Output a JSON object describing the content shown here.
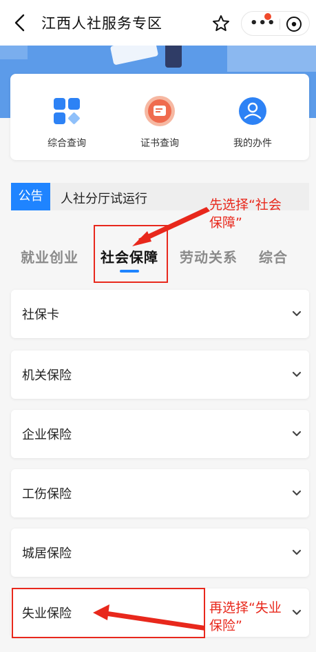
{
  "nav": {
    "title": "江西人社服务专区",
    "more_glyph": "•••"
  },
  "quick": [
    {
      "label": "综合查询",
      "icon": "grid-icon"
    },
    {
      "label": "证书查询",
      "icon": "certificate-icon"
    },
    {
      "label": "我的办件",
      "icon": "user-profile-icon"
    }
  ],
  "notice": {
    "tag": "公告",
    "text": "人社分厅试运行"
  },
  "tabs": [
    {
      "label": "就业创业"
    },
    {
      "label": "社会保障"
    },
    {
      "label": "劳动关系"
    },
    {
      "label": "综合"
    }
  ],
  "list": [
    {
      "label": "社保卡"
    },
    {
      "label": "机关保险"
    },
    {
      "label": "企业保险"
    },
    {
      "label": "工伤保险"
    },
    {
      "label": "城居保险"
    },
    {
      "label": "失业保险"
    }
  ],
  "annotations": {
    "first": {
      "line1": "先选择“社会",
      "line2": "保障”"
    },
    "second": {
      "line1": "再选择“失业",
      "line2": "保险”"
    }
  },
  "colors": {
    "accent": "#1f84ff",
    "annotation": "#e8281c",
    "banner": "#5c9be9"
  }
}
